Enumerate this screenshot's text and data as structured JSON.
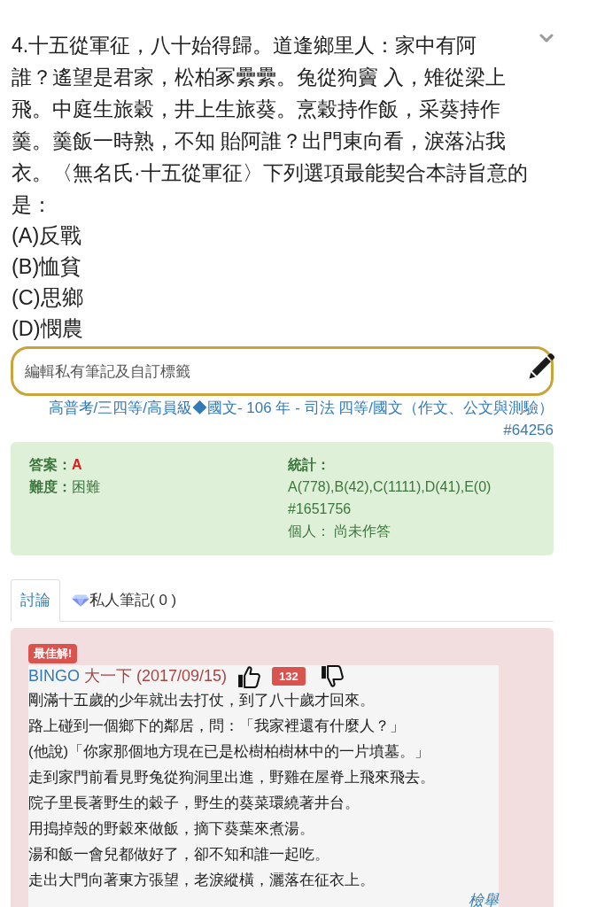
{
  "question": {
    "lines": [
      "4.十五從軍征，八十始得歸。道逢鄉里人：家中有阿",
      "誰？遙望是君家，松柏冢纍纍。兔從狗竇 入，雉從梁上",
      "飛。中庭生旅穀，井上生旅葵。烹穀持作飯，采葵持作",
      "羹。羹飯一時熟，不知 貽阿誰？出門東向看，淚落沾我",
      "衣。〈無名氏·十五從軍征〉下列選項最能契合本詩旨意的",
      "是："
    ],
    "options": [
      "(A)反戰",
      "(B)恤貧",
      "(C)思鄉",
      "(D)憫農"
    ]
  },
  "note_field": {
    "placeholder": "編輯私有筆記及自訂標籤"
  },
  "category": {
    "path": "高普考/三四等/高員級◆國文- 106 年 - 司法 四等/國文（作文、公文與測驗）",
    "question_id": "#64256"
  },
  "answer_panel": {
    "answer_label": "答案：",
    "answer": "A",
    "difficulty_label": "難度：",
    "difficulty": "困難",
    "stats_label": "統計：",
    "stats": "A(778),B(42),C(1111),D(41),E(0)",
    "stats_id": "#1651756",
    "personal": "個人： 尚未作答"
  },
  "tabs": [
    {
      "label": "討論",
      "selected": true,
      "kind": "text"
    },
    {
      "label": "私人筆記( 0 )",
      "selected": false,
      "kind": "icon"
    }
  ],
  "best_answer": {
    "badge": "最佳解!",
    "author": "BINGO",
    "author_info": "大一下 (2017/09/15)",
    "likes": "132",
    "lines": [
      "剛滿十五歲的少年就出去打仗，到了八十歲才回來。",
      "路上碰到一個鄉下的鄰居，問：「我家裡還有什麼人？」",
      "(他說)「你家那個地方現在已是松樹柏樹林中的一片墳墓。」",
      "走到家門前看見野兔從狗洞里出進，野雞在屋脊上飛來飛去。",
      "院子里長著野生的穀子，野生的葵菜環繞著井台。",
      "用搗掉殼的野穀來做飯，摘下葵葉來煮湯。",
      "湯和飯一會兒都做好了，卻不知和誰一起吃。",
      "走出大門向著東方張望，老淚縱橫，灑落在征衣上。"
    ],
    "report_link": "檢舉"
  }
}
